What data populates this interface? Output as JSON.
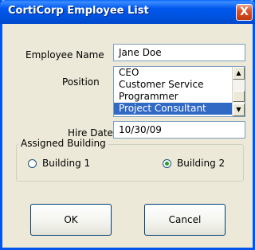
{
  "window": {
    "title": "CortiCorp Employee List",
    "close_glyph": "X"
  },
  "form": {
    "employee_name_label": "Employee Name",
    "employee_name_value": "Jane Doe",
    "position_label": "Position",
    "position_options": [
      "CEO",
      "Customer Service",
      "Programmer",
      "Project Consultant"
    ],
    "position_selected": "Project Consultant",
    "hire_date_label": "Hire Date",
    "hire_date_value": "10/30/09"
  },
  "assigned_building": {
    "legend": "Assigned Building",
    "options": [
      {
        "label": "Building 1",
        "selected": false
      },
      {
        "label": "Building 2",
        "selected": true
      }
    ]
  },
  "buttons": {
    "ok_label": "OK",
    "cancel_label": "Cancel"
  },
  "icons": {
    "scroll_up": "scroll-up-arrow-icon",
    "scroll_down": "scroll-down-arrow-icon",
    "close": "close-icon"
  },
  "colors": {
    "titlebar": "#0054e3",
    "selection": "#316ac5",
    "dialog_bg": "#ece9d8",
    "close_button": "#c1390f"
  }
}
